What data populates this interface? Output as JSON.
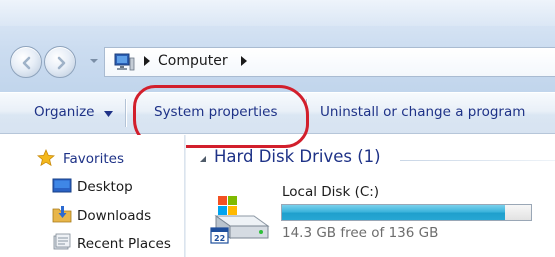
{
  "address": {
    "breadcrumb": [
      "Computer"
    ]
  },
  "commandbar": {
    "organize_label": "Organize",
    "system_properties_label": "System properties",
    "uninstall_label": "Uninstall or change a program"
  },
  "navigation": {
    "favorites_label": "Favorites",
    "items": [
      {
        "label": "Desktop",
        "icon": "desktop-icon"
      },
      {
        "label": "Downloads",
        "icon": "downloads-icon"
      },
      {
        "label": "Recent Places",
        "icon": "recent-places-icon"
      }
    ]
  },
  "content": {
    "group_header": "Hard Disk Drives (1)",
    "drives": [
      {
        "name": "Local Disk (C:)",
        "free_text": "14.3 GB free of 136 GB",
        "used_fraction": 0.895
      }
    ]
  },
  "colors": {
    "highlight_ring": "#d21f2c",
    "link_blue": "#1e3287",
    "usage_bar": "#2aa8d6"
  }
}
